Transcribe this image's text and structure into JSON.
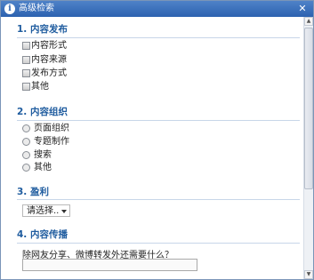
{
  "window": {
    "title": "高级检索",
    "title_icon": "info-icon",
    "close_icon": "close-icon"
  },
  "sections": [
    {
      "title": "1. 内容发布",
      "type": "checkbox",
      "options": [
        "内容形式",
        "内容来源",
        "发布方式",
        "其他"
      ]
    },
    {
      "title": "2. 内容组织",
      "type": "radio",
      "options": [
        "页面组织",
        "专题制作",
        "搜索",
        "其他"
      ]
    },
    {
      "title": "3. 盈利",
      "type": "select",
      "selected": "请选择.."
    },
    {
      "title": "4. 内容传播",
      "type": "text",
      "question": "除网友分享、微博转发外还需要什么？",
      "value": ""
    }
  ],
  "colors": {
    "titlebar": "#2c62b0",
    "section_title": "#1f5c9f",
    "divider": "#c8d6e8"
  }
}
